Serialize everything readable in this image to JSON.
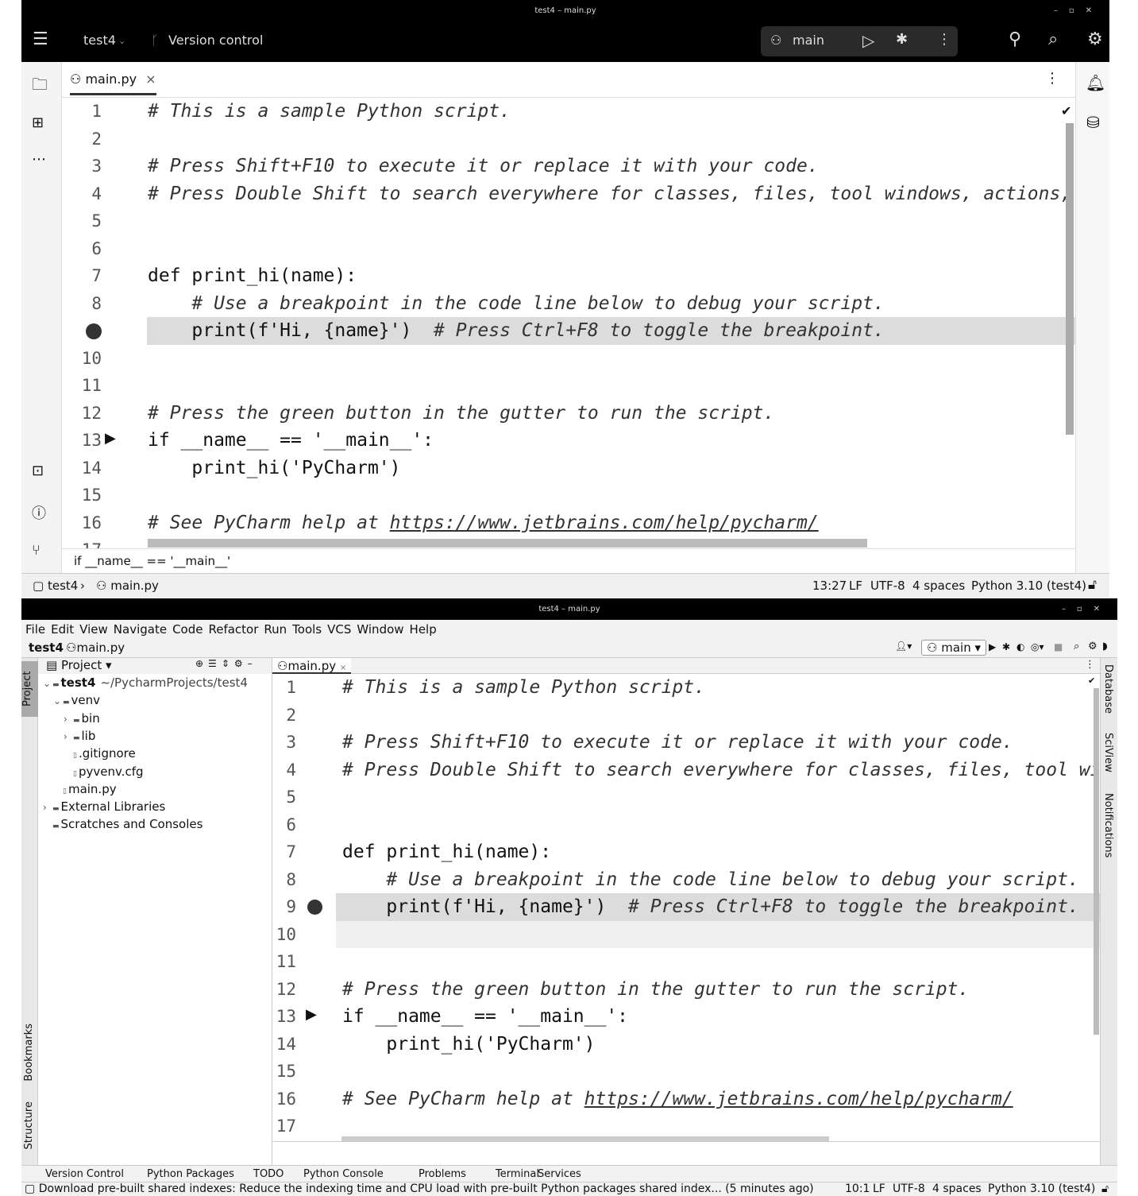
{
  "top": {
    "window_title": "test4 – main.py",
    "project": "test4",
    "vcs": "Version control",
    "run_config": "main",
    "tab": "main.py",
    "breadcrumb_code": "if __name__ == '__main__'",
    "status": {
      "path_project": "test4",
      "path_file": "main.py",
      "position": "13:27",
      "line_sep": "LF",
      "encoding": "UTF-8",
      "indent": "4 spaces",
      "interpreter": "Python 3.10 (test4)"
    }
  },
  "bottom": {
    "window_title": "test4 – main.py",
    "menu": [
      "File",
      "Edit",
      "View",
      "Navigate",
      "Code",
      "Refactor",
      "Run",
      "Tools",
      "VCS",
      "Window",
      "Help"
    ],
    "breadcrumb_project": "test4",
    "breadcrumb_file": "main.py",
    "run_config": "main",
    "project_panel_title": "Project",
    "tree": [
      {
        "label": "test4",
        "extra": "~/PycharmProjects/test4",
        "depth": 0,
        "arrow": "⌄"
      },
      {
        "label": "venv",
        "depth": 1,
        "arrow": "⌄"
      },
      {
        "label": "bin",
        "depth": 2,
        "arrow": "›"
      },
      {
        "label": "lib",
        "depth": 2,
        "arrow": "›"
      },
      {
        "label": ".gitignore",
        "depth": 2,
        "arrow": ""
      },
      {
        "label": "pyvenv.cfg",
        "depth": 2,
        "arrow": ""
      },
      {
        "label": "main.py",
        "depth": 1,
        "arrow": ""
      },
      {
        "label": "External Libraries",
        "depth": 0,
        "arrow": "›"
      },
      {
        "label": "Scratches and Consoles",
        "depth": 0,
        "arrow": ""
      }
    ],
    "tab": "main.py",
    "left_tools": [
      "Project",
      "Bookmarks",
      "Structure"
    ],
    "right_tools": [
      "Database",
      "SciView",
      "Notifications"
    ],
    "tool_windows": [
      "Version Control",
      "Python Packages",
      "TODO",
      "Python Console",
      "Problems",
      "Terminal",
      "Services"
    ],
    "status_message": "Download pre-built shared indexes: Reduce the indexing time and CPU load with pre-built Python packages shared index... (5 minutes ago)",
    "status": {
      "position": "10:1",
      "line_sep": "LF",
      "encoding": "UTF-8",
      "indent": "4 spaces",
      "interpreter": "Python 3.10 (test4)"
    }
  },
  "code": [
    "# This is a sample Python script.",
    "",
    "# Press Shift+F10 to execute it or replace it with your code.",
    "# Press Double Shift to search everywhere for classes, files, tool windows, actions, and settings.",
    "",
    "",
    "def print_hi(name):",
    "    # Use a breakpoint in the code line below to debug your script.",
    "    print(f'Hi, {name}')  # Press Ctrl+F8 to toggle the breakpoint.",
    "",
    "",
    "# Press the green button in the gutter to run the script.",
    "if __name__ == '__main__':",
    "    print_hi('PyCharm')",
    "",
    "# See PyCharm help at https://www.jetbrains.com/help/pycharm/",
    ""
  ]
}
